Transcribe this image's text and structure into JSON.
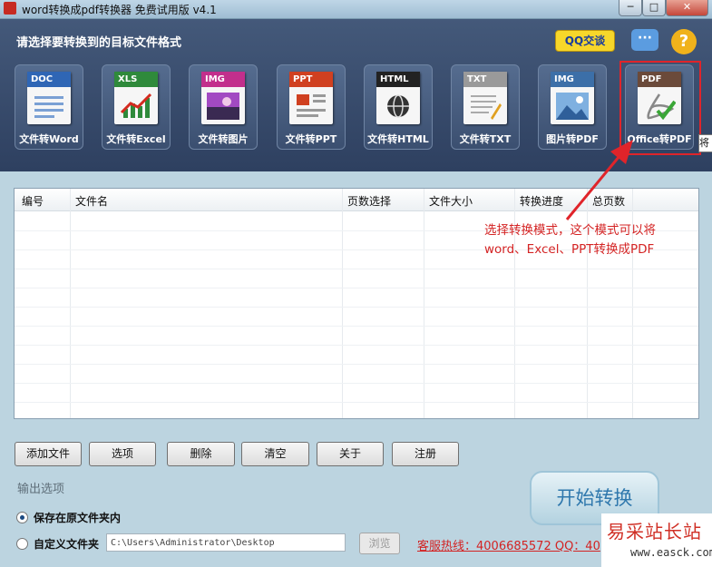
{
  "window": {
    "title": "word转换成pdf转换器 免费试用版 v4.1",
    "min_label": "─",
    "max_label": "□",
    "close_label": "✕"
  },
  "header": {
    "prompt": "请选择要转换到的目标文件格式",
    "qq_label": "QQ交谈",
    "chat_label": "···",
    "help_label": "?"
  },
  "tiles": [
    {
      "tag": "DOC",
      "label": "文件转Word",
      "tag_color": "#2f66b5",
      "icon": "doc-file-icon"
    },
    {
      "tag": "XLS",
      "label": "文件转Excel",
      "tag_color": "#2f8a3b",
      "icon": "xls-chart-icon"
    },
    {
      "tag": "IMG",
      "label": "文件转图片",
      "tag_color": "#c22f8c",
      "icon": "image-file-icon"
    },
    {
      "tag": "PPT",
      "label": "文件转PPT",
      "tag_color": "#d04020",
      "icon": "ppt-file-icon"
    },
    {
      "tag": "HTML",
      "label": "文件转HTML",
      "tag_color": "#222222",
      "icon": "html-globe-icon"
    },
    {
      "tag": "TXT",
      "label": "文件转TXT",
      "tag_color": "#9a9a9a",
      "icon": "txt-file-icon"
    },
    {
      "tag": "IMG",
      "label": "图片转PDF",
      "tag_color": "#3c6fa8",
      "icon": "image-to-pdf-icon"
    },
    {
      "tag": "PDF",
      "label": "Office转PDF",
      "tag_color": "#6b4a3a",
      "icon": "office-to-pdf-icon"
    }
  ],
  "tooltip_text": "将",
  "file_list": {
    "columns": [
      "编号",
      "文件名",
      "页数选择",
      "文件大小",
      "转换进度",
      "总页数"
    ]
  },
  "annotation": [
    "选择转换模式，这个模式可以将",
    "word、Excel、PPT转换成PDF"
  ],
  "buttons": {
    "add": "添加文件",
    "options": "选项",
    "delete": "删除",
    "clear": "清空",
    "about": "关于",
    "register": "注册"
  },
  "output": {
    "section_title": "输出选项",
    "save_original": "保存在原文件夹内",
    "custom_folder": "自定义文件夹",
    "path_value": "C:\\Users\\Administrator\\Desktop",
    "browse": "浏览",
    "selected_option": "保存在原文件夹内"
  },
  "hotline": "客服热线：4006685572 QQ：40",
  "start_button": "开始转换",
  "watermark": {
    "cn": "易采站长站",
    "url": "www.easck.com"
  },
  "colors": {
    "header_bg": "#3b4f70",
    "highlight_border": "#e0242a",
    "annotation_text": "#d42424"
  }
}
